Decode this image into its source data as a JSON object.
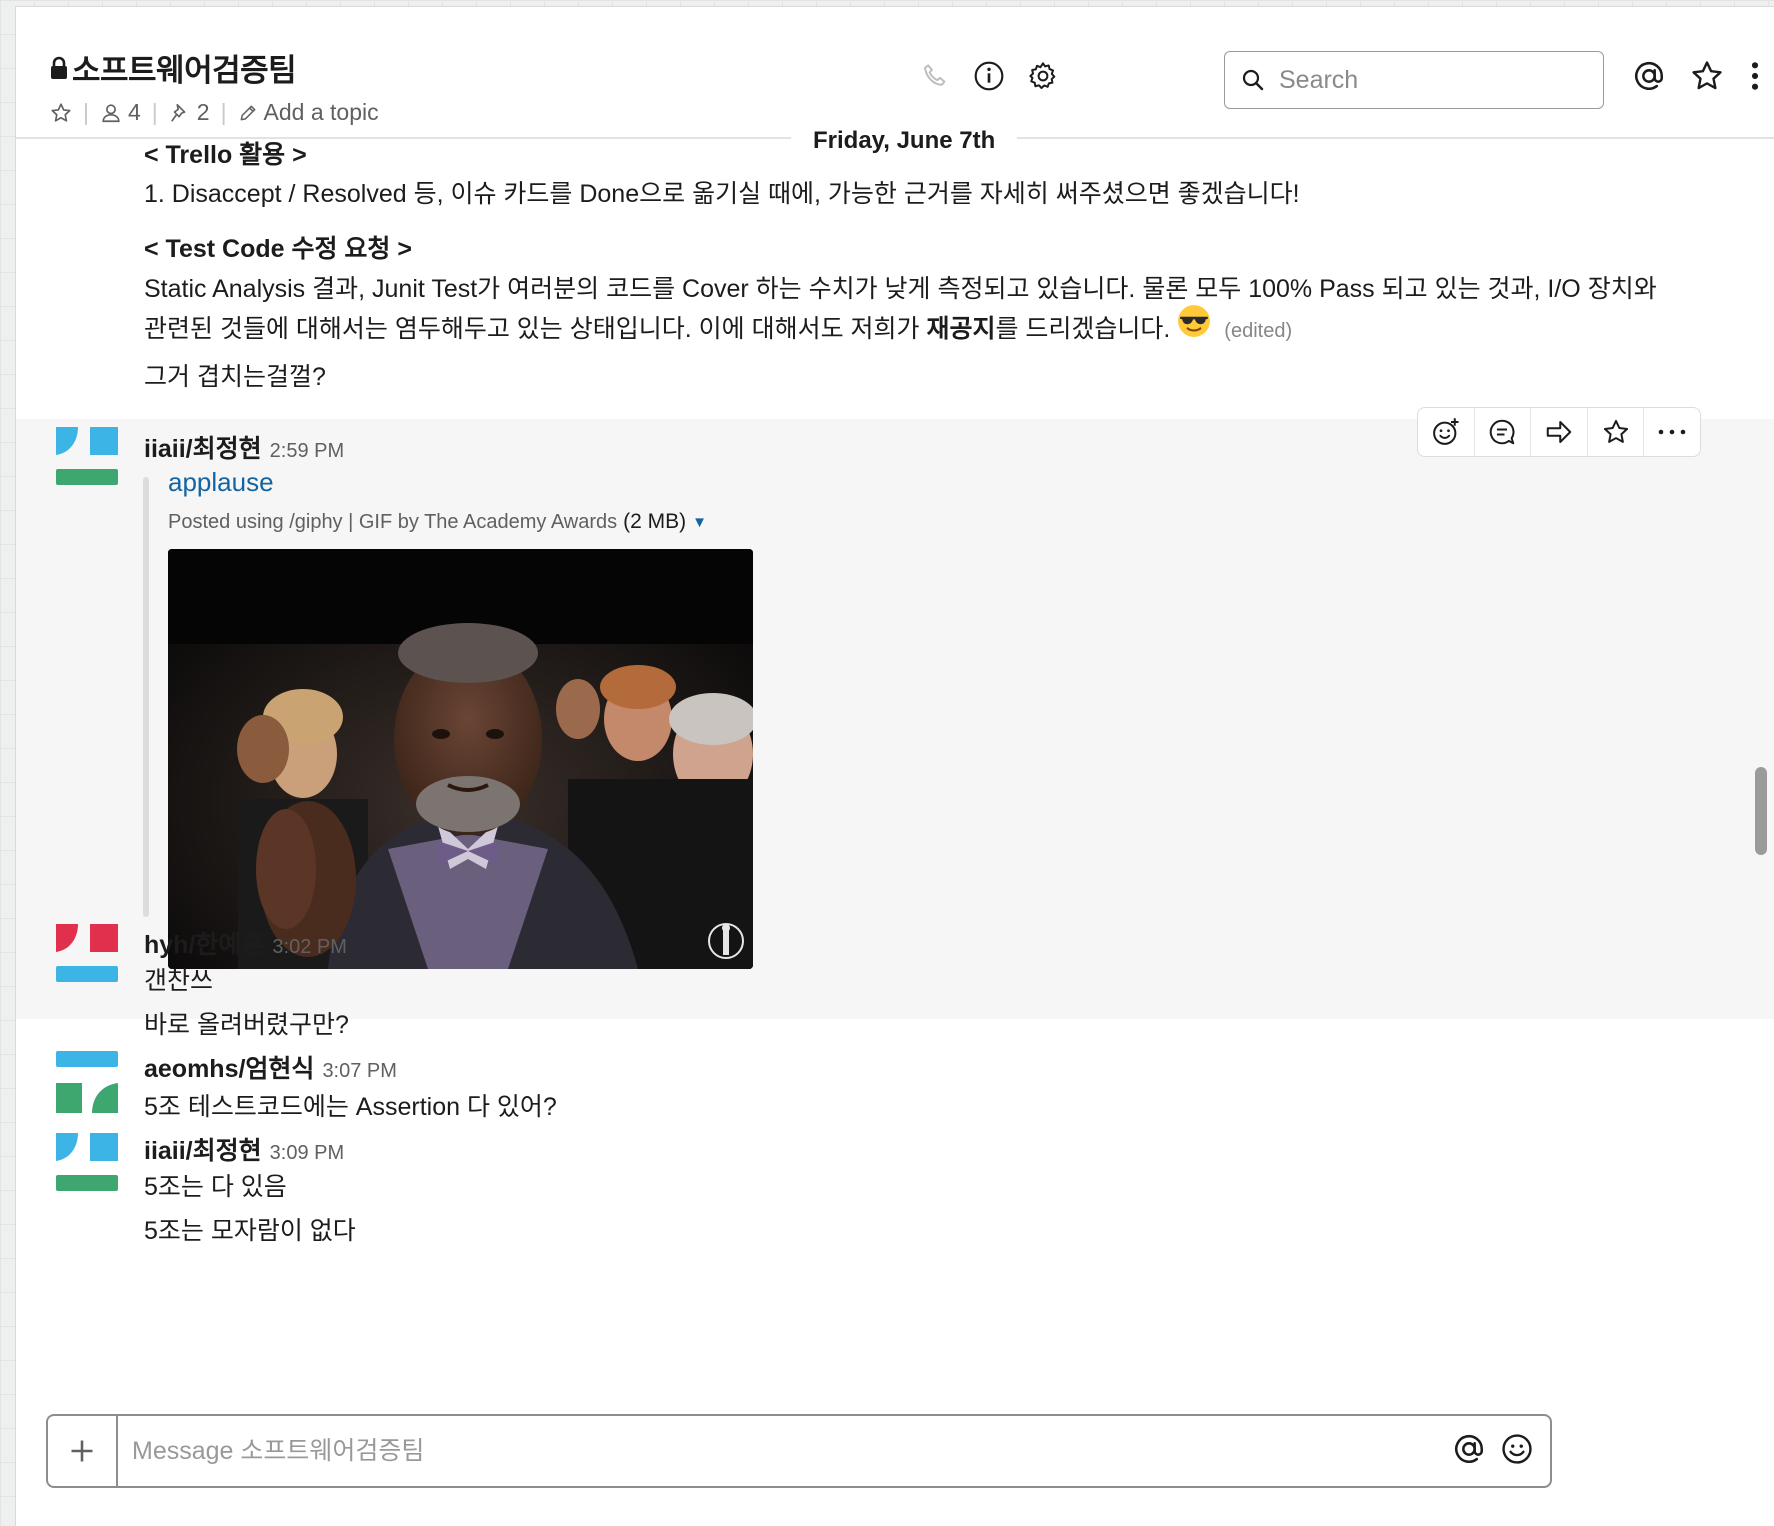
{
  "header": {
    "channel_name": "소프트웨어검증팀",
    "members_count": "4",
    "pins_count": "2",
    "add_topic_label": "Add a topic",
    "search_placeholder": "Search"
  },
  "date_divider": "Friday, June 7th",
  "prev_message": {
    "line1": "< Trello 활용 >",
    "line2": "1. Disaccept / Resolved 등, 이슈 카드를 Done으로 옮기실 때에, 가능한 근거를 자세히 써주셨으면 좋겠습니다!",
    "line3": "< Test Code 수정 요청 >",
    "line4": "Static Analysis 결과, Junit Test가 여러분의 코드를 Cover 하는 수치가 낮게 측정되고 있습니다. 물론 모두 100% Pass 되고 있는 것과, I/O 장치와",
    "line5_pre": "관련된 것들에 대해서는 염두해두고 있는 상태입니다. 이에 대해서도 저희가 ",
    "line5_bold": "재공지",
    "line5_post": "를 드리겠습니다.",
    "edited": "(edited)",
    "line6": "그거 겹치는걸껄?"
  },
  "messages": [
    {
      "sender": "iiaii/최정현",
      "time": "2:59 PM",
      "attachment_title": "applause",
      "attachment_meta": "Posted using /giphy | GIF by The Academy Awards",
      "attachment_size": "(2 MB)"
    },
    {
      "sender": "hyh/한예훈",
      "time": "3:02 PM",
      "lines": [
        "갠찬쓰",
        "바로 올려버렸구만?"
      ]
    },
    {
      "sender": "aeomhs/엄현식",
      "time": "3:07 PM",
      "lines": [
        "5조 테스트코드에는 Assertion 다 있어?"
      ]
    },
    {
      "sender": "iiaii/최정현",
      "time": "3:09 PM",
      "lines": [
        "5조는 다 있음",
        "5조는 모자람이 없다"
      ]
    }
  ],
  "composer": {
    "placeholder": "Message 소프트웨어검증팀"
  },
  "colors": {
    "link": "#1264a3",
    "avatar_blue": "#3cb4e5",
    "avatar_green": "#3ea770",
    "avatar_red": "#e0304e"
  }
}
